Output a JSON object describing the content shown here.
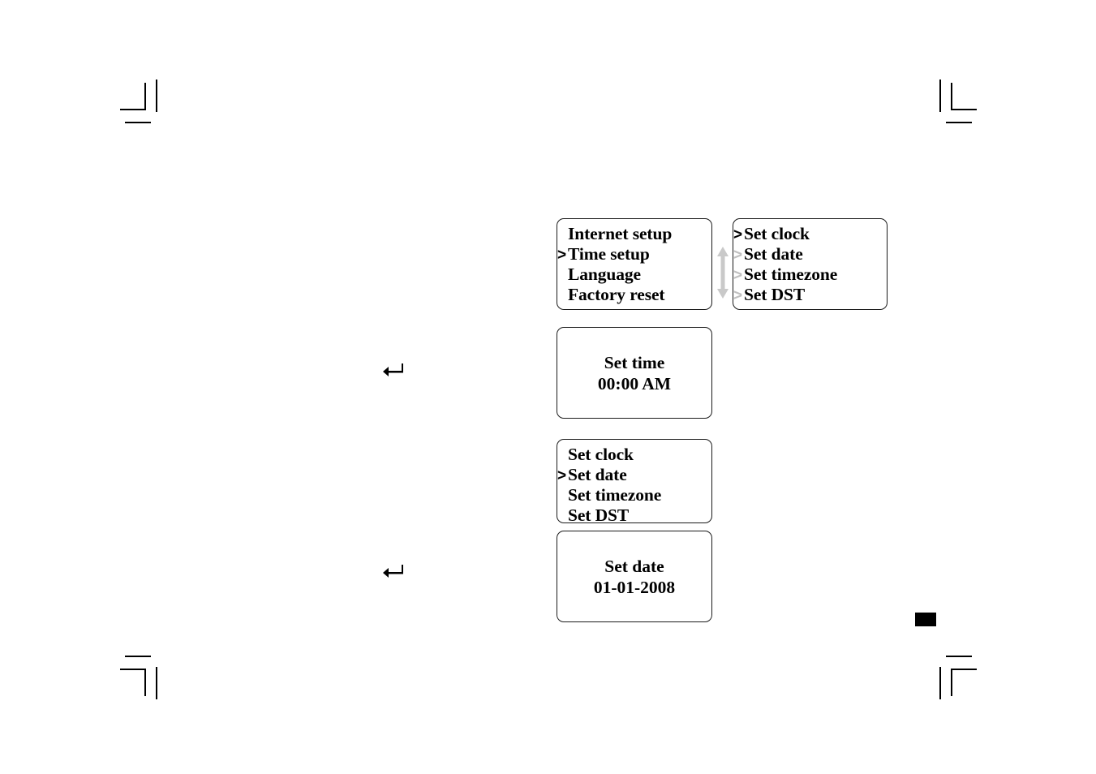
{
  "page": {
    "background_color": "#ffffff",
    "text_color": "#000000",
    "selected_chevron_color": "#000000",
    "unselected_chevron_color": "#bfbfbf",
    "scroll_arrow_color": "#c9c9c9"
  },
  "screens": [
    {
      "id": "setup-menu",
      "type": "menu",
      "items": [
        {
          "label": "Internet setup",
          "chevron": "none"
        },
        {
          "label": "Time setup",
          "chevron": "selected"
        },
        {
          "label": "Language",
          "chevron": "none"
        },
        {
          "label": "Factory reset",
          "chevron": "none"
        }
      ]
    },
    {
      "id": "time-setup-menu",
      "type": "menu",
      "items": [
        {
          "label": "Set clock",
          "chevron": "selected"
        },
        {
          "label": "Set date",
          "chevron": "unselected"
        },
        {
          "label": "Set timezone",
          "chevron": "unselected"
        },
        {
          "label": "Set DST",
          "chevron": "unselected"
        }
      ]
    },
    {
      "id": "set-time-value",
      "type": "value",
      "title": "Set time",
      "value": "00:00 AM"
    },
    {
      "id": "clock-menu",
      "type": "menu",
      "items": [
        {
          "label": "Set clock",
          "chevron": "none"
        },
        {
          "label": "Set date",
          "chevron": "selected"
        },
        {
          "label": "Set timezone",
          "chevron": "none"
        },
        {
          "label": "Set DST",
          "chevron": "none"
        }
      ]
    },
    {
      "id": "set-date-value",
      "type": "value",
      "title": "Set date",
      "value": "01-01-2008"
    }
  ],
  "icons": {
    "scroll_updown": "scroll-updown-arrow-icon",
    "return_arrow": "return-arrow-icon",
    "page_marker": "page-marker-block",
    "crop_mark": "crop-mark"
  }
}
